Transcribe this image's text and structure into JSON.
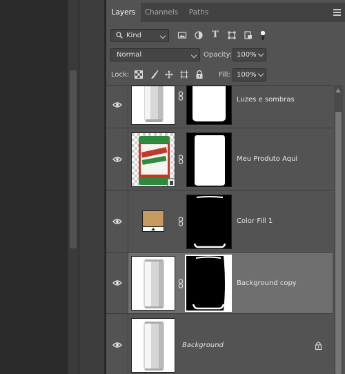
{
  "tabs": [
    {
      "label": "Layers",
      "active": true
    },
    {
      "label": "Channels",
      "active": false
    },
    {
      "label": "Paths",
      "active": false
    }
  ],
  "filter": {
    "kind_label": "Kind",
    "icons": [
      "image-filter-icon",
      "adjustment-filter-icon",
      "type-filter-icon",
      "shape-filter-icon",
      "smart-object-filter-icon",
      "filter-toggle-icon"
    ]
  },
  "blend": {
    "mode": "Normal",
    "opacity_label": "Opacity:",
    "opacity_value": "100%",
    "lock_label": "Lock:",
    "fill_label": "Fill:",
    "fill_value": "100%"
  },
  "layers": [
    {
      "name": "Luzes e sombras",
      "thumb": "can",
      "mask": "can-white",
      "selected": false,
      "italic": false,
      "locked": false
    },
    {
      "name": "Meu Produto Aqui",
      "thumb": "label-smart-object",
      "mask": "can-white",
      "selected": false,
      "italic": false,
      "locked": false
    },
    {
      "name": "Color Fill 1",
      "thumb": "color-fill",
      "mask": "outline",
      "selected": false,
      "italic": false,
      "locked": false
    },
    {
      "name": "Background copy",
      "thumb": "can",
      "mask": "outline",
      "selected": true,
      "italic": false,
      "locked": false
    },
    {
      "name": "Background",
      "thumb": "can",
      "mask": null,
      "selected": false,
      "italic": true,
      "locked": true
    }
  ],
  "colors": {
    "panel_bg": "#535353",
    "selected_row": "#6f6f6f",
    "color_fill_swatch": "#c49a5e"
  }
}
